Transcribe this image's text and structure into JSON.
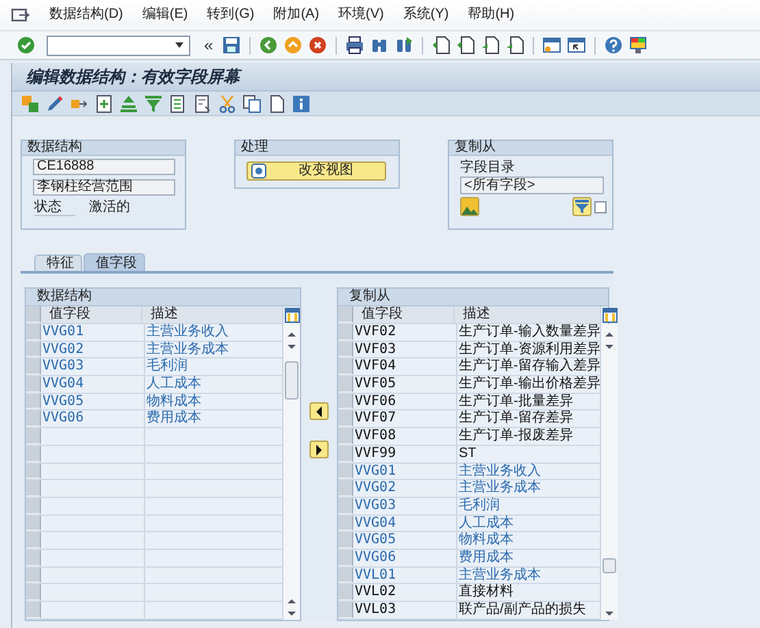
{
  "menu": [
    {
      "label": "数据结构(D)"
    },
    {
      "label": "编辑(E)"
    },
    {
      "label": "转到(G)"
    },
    {
      "label": "附加(A)"
    },
    {
      "label": "环境(V)"
    },
    {
      "label": "系统(Y)"
    },
    {
      "label": "帮助(H)"
    }
  ],
  "toolbar": {
    "collapse_glyph": "«"
  },
  "title": "编辑数据结构：有效字段屏幕",
  "data_structure_group": {
    "title": "数据结构",
    "name": "CE16888",
    "description": "李钢柱经营范围",
    "status_label": "状态",
    "status_value": "激活的"
  },
  "processing_group": {
    "title": "处理",
    "button": "改变视图"
  },
  "copy_from_group": {
    "title": "复制从",
    "catalog_label": "字段目录",
    "catalog_value": "<所有字段>",
    "filter_checked": false
  },
  "tabs": [
    {
      "label": "特征",
      "selected": false
    },
    {
      "label": "值字段",
      "selected": true
    }
  ],
  "left_table": {
    "title": "数据结构",
    "columns": [
      "值字段",
      "描述"
    ],
    "rows": [
      {
        "field": "VVG01",
        "description": "主营业务收入",
        "in_structure": true
      },
      {
        "field": "VVG02",
        "description": "主营业务成本",
        "in_structure": true
      },
      {
        "field": "VVG03",
        "description": "毛利润",
        "in_structure": true
      },
      {
        "field": "VVG04",
        "description": "人工成本",
        "in_structure": true
      },
      {
        "field": "VVG05",
        "description": "物料成本",
        "in_structure": true
      },
      {
        "field": "VVG06",
        "description": "费用成本",
        "in_structure": true
      }
    ]
  },
  "right_table": {
    "title": "复制从",
    "columns": [
      "值字段",
      "描述"
    ],
    "rows": [
      {
        "field": "VVF02",
        "description": "生产订单-输入数量差异",
        "in_structure": false
      },
      {
        "field": "VVF03",
        "description": "生产订单-资源利用差异",
        "in_structure": false
      },
      {
        "field": "VVF04",
        "description": "生产订单-留存输入差异",
        "in_structure": false
      },
      {
        "field": "VVF05",
        "description": "生产订单-输出价格差异",
        "in_structure": false
      },
      {
        "field": "VVF06",
        "description": "生产订单-批量差异",
        "in_structure": false
      },
      {
        "field": "VVF07",
        "description": "生产订单-留存差异",
        "in_structure": false
      },
      {
        "field": "VVF08",
        "description": "生产订单-报废差异",
        "in_structure": false
      },
      {
        "field": "VVF99",
        "description": "ST",
        "in_structure": false
      },
      {
        "field": "VVG01",
        "description": "主营业务收入",
        "in_structure": true
      },
      {
        "field": "VVG02",
        "description": "主营业务成本",
        "in_structure": true
      },
      {
        "field": "VVG03",
        "description": "毛利润",
        "in_structure": true
      },
      {
        "field": "VVG04",
        "description": "人工成本",
        "in_structure": true
      },
      {
        "field": "VVG05",
        "description": "物料成本",
        "in_structure": true
      },
      {
        "field": "VVG06",
        "description": "费用成本",
        "in_structure": true
      },
      {
        "field": "VVL01",
        "description": "主营业务成本",
        "in_structure": true
      },
      {
        "field": "VVL02",
        "description": "直接材料",
        "in_structure": false
      },
      {
        "field": "VVL03",
        "description": "联产品/副产品的损失",
        "in_structure": false
      }
    ]
  }
}
